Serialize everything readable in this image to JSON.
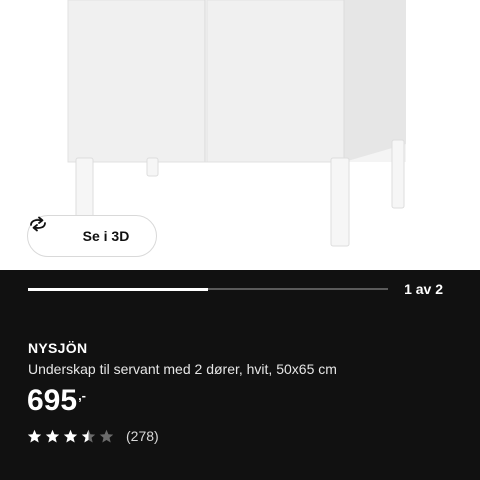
{
  "product_image": {
    "view_3d_label": "Se i 3D",
    "view_3d_icon": "rotate-3d-icon"
  },
  "gallery": {
    "current": 1,
    "total": 2,
    "progress_fraction": 0.5,
    "pager_text": "1 av 2"
  },
  "product": {
    "brand": "NYSJÖN",
    "description": "Underskap til servant med 2 dører, hvit, 50x65 cm",
    "price": "695",
    "price_suffix": ",-",
    "rating": 3.5,
    "rating_max": 5,
    "review_count": "(278)"
  },
  "colors": {
    "panel_bg": "#111111",
    "star_filled": "#ffffff",
    "star_empty": "#6b6b6b"
  }
}
